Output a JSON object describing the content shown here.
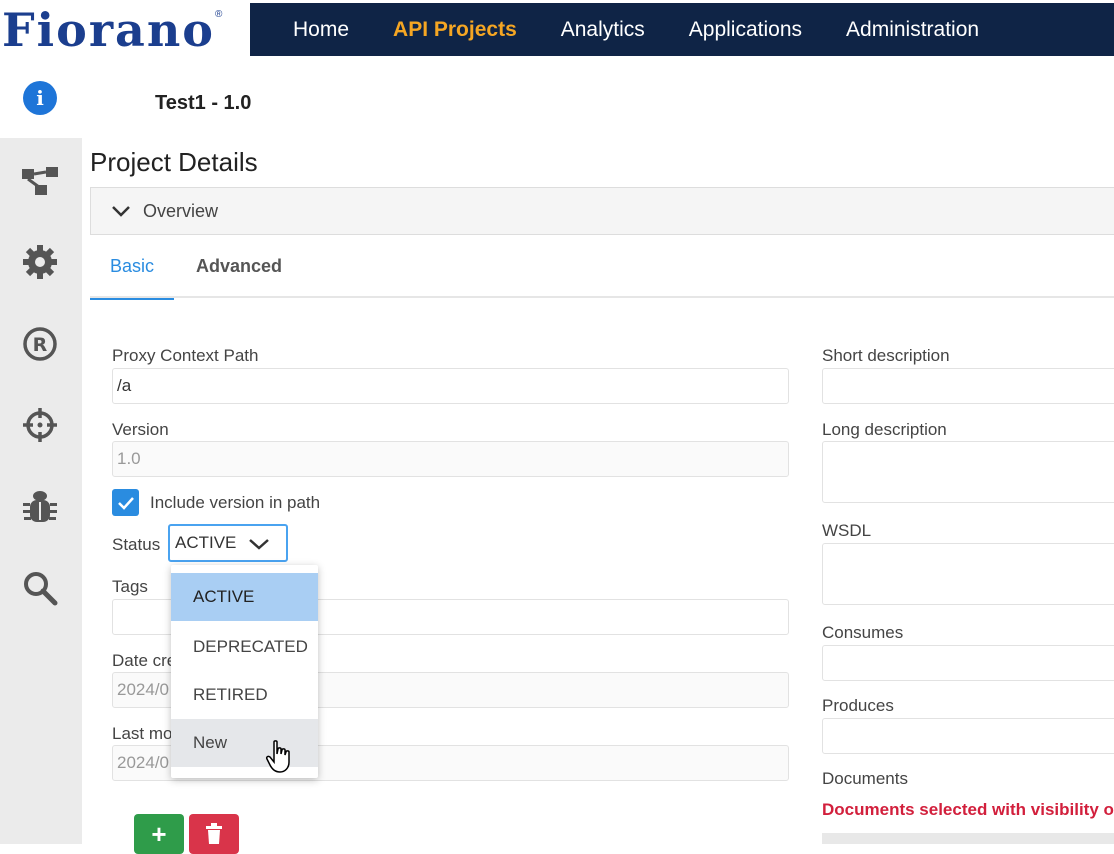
{
  "brand": {
    "logo_text": "Fiorano",
    "logo_mark": "®",
    "color": "#1b3e8e"
  },
  "nav": {
    "items": [
      "Home",
      "API Projects",
      "Analytics",
      "Applications",
      "Administration"
    ],
    "active": "API Projects",
    "accent": "#f5a623",
    "background": "#0f2446"
  },
  "sidebar": {
    "icons": [
      "info-icon",
      "flow-icon",
      "gear-icon",
      "registered-icon",
      "crosshair-icon",
      "bug-icon",
      "search-icon"
    ]
  },
  "header": {
    "project_title": "Test1 - 1.0",
    "page_title": "Project Details"
  },
  "overview": {
    "label": "Overview"
  },
  "tabs": {
    "basic": "Basic",
    "advanced": "Advanced",
    "active": "Basic"
  },
  "left_form": {
    "proxy_label": "Proxy Context Path",
    "proxy_value": "/a",
    "version_label": "Version",
    "version_value": "1.0",
    "include_version_label": "Include version in path",
    "include_version_checked": true,
    "status_label": "Status",
    "status_value": "ACTIVE",
    "tags_label": "Tags",
    "date_created_label": "Date cre",
    "date_created_value": "2024/0",
    "last_modified_label": "Last mo",
    "last_modified_value": "2024/0"
  },
  "status_dropdown": {
    "options": [
      "ACTIVE",
      "DEPRECATED",
      "RETIRED",
      "New"
    ],
    "selected": "ACTIVE",
    "hovered": "New"
  },
  "right_form": {
    "short_desc_label": "Short description",
    "long_desc_label": "Long description",
    "wsdl_label": "WSDL",
    "consumes_label": "Consumes",
    "produces_label": "Produces",
    "documents_label": "Documents",
    "documents_warning": "Documents selected with visibility o"
  },
  "buttons": {
    "add_label": "+"
  },
  "colors": {
    "accent_blue": "#2a8ce0",
    "add_green": "#2f9c4a",
    "delete_red": "#d9344a",
    "warning_red": "#d21f3c"
  }
}
